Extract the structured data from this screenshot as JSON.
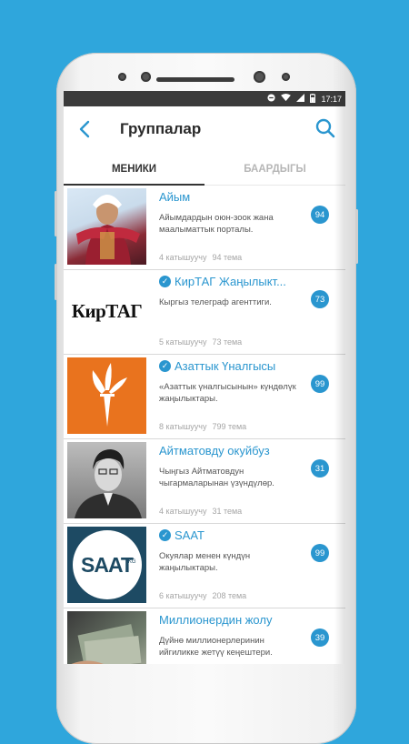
{
  "status_bar": {
    "time": "17:17"
  },
  "header": {
    "title": "Группалар"
  },
  "tabs": [
    {
      "label": "МЕНИКИ"
    },
    {
      "label": "БААРДЫГЫ"
    }
  ],
  "groups": [
    {
      "name": "Айым",
      "verified": false,
      "description": "Айымдардын оюн-зоок жана маалыматтык порталы.",
      "members": "4 катышуучу",
      "topics": "94 тема",
      "count": "94"
    },
    {
      "name": "КирТАГ Жаңылыкт...",
      "verified": true,
      "description": "Кыргыз телеграф агенттиги.",
      "members": "5 катышуучу",
      "topics": "73 тема",
      "count": "73",
      "logo_text": "КирТАГ"
    },
    {
      "name": "Азаттык Үналгысы",
      "verified": true,
      "description": "«Азаттык үналгысынын» күндөлүк жаңылыктары.",
      "members": "8 катышуучу",
      "topics": "799 тема",
      "count": "99"
    },
    {
      "name": "Айтматовду окуйбуз",
      "verified": false,
      "description": "Чыңгыз Айтматовдун чыгармаларынан үзүндүлөр.",
      "members": "4 катышуучу",
      "topics": "31 тема",
      "count": "31"
    },
    {
      "name": "SAAT",
      "verified": true,
      "description": "Окуялар менен күндүн жаңылыктары.",
      "members": "6 катышуучу",
      "topics": "208 тема",
      "count": "99",
      "logo_text": "SAAT",
      "logo_sub": "KG"
    },
    {
      "name": "Миллионердин жолу",
      "verified": false,
      "description": "Дүйнө миллионерлеринин ийгиликке жетүү кеңештери.",
      "members": "",
      "topics": "",
      "count": "39"
    }
  ]
}
